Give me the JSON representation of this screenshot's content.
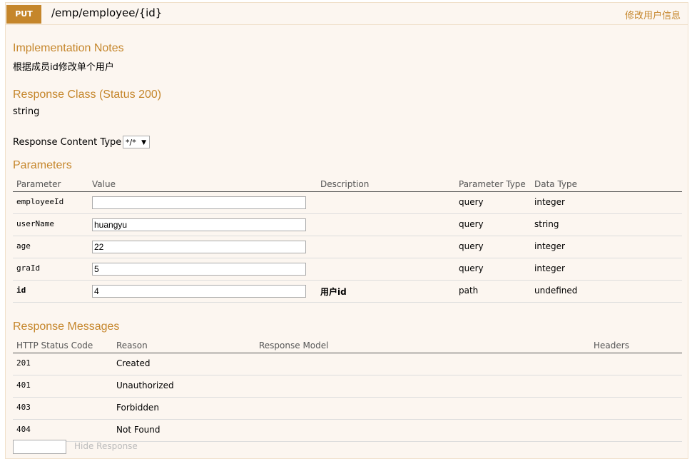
{
  "operation": {
    "method": "PUT",
    "path": "/emp/employee/{id}",
    "summary": "修改用户信息"
  },
  "implementation_notes": {
    "title": "Implementation Notes",
    "text": "根据成员id修改单个用户"
  },
  "response_class": {
    "title": "Response Class (Status 200)",
    "type": "string"
  },
  "response_content_type": {
    "label": "Response Content Type",
    "selected": "*/*"
  },
  "parameters": {
    "title": "Parameters",
    "headers": [
      "Parameter",
      "Value",
      "Description",
      "Parameter Type",
      "Data Type"
    ],
    "rows": [
      {
        "name": "employeeId",
        "value": "",
        "description": "",
        "param_type": "query",
        "data_type": "integer"
      },
      {
        "name": "userName",
        "value": "huangyu",
        "description": "",
        "param_type": "query",
        "data_type": "string"
      },
      {
        "name": "age",
        "value": "22",
        "description": "",
        "param_type": "query",
        "data_type": "integer"
      },
      {
        "name": "graId",
        "value": "5",
        "description": "",
        "param_type": "query",
        "data_type": "integer"
      },
      {
        "name": "id",
        "value": "4",
        "description": "用户id",
        "param_type": "path",
        "data_type": "undefined"
      }
    ]
  },
  "response_messages": {
    "title": "Response Messages",
    "headers": [
      "HTTP Status Code",
      "Reason",
      "Response Model",
      "Headers"
    ],
    "rows": [
      {
        "code": "201",
        "reason": "Created"
      },
      {
        "code": "401",
        "reason": "Unauthorized"
      },
      {
        "code": "403",
        "reason": "Forbidden"
      },
      {
        "code": "404",
        "reason": "Not Found"
      }
    ]
  },
  "hide_response_label": "Hide Response",
  "colors": {
    "accent": "#c5862b",
    "panel_bg": "#fcf6f0",
    "panel_border": "#f0e0ca"
  }
}
